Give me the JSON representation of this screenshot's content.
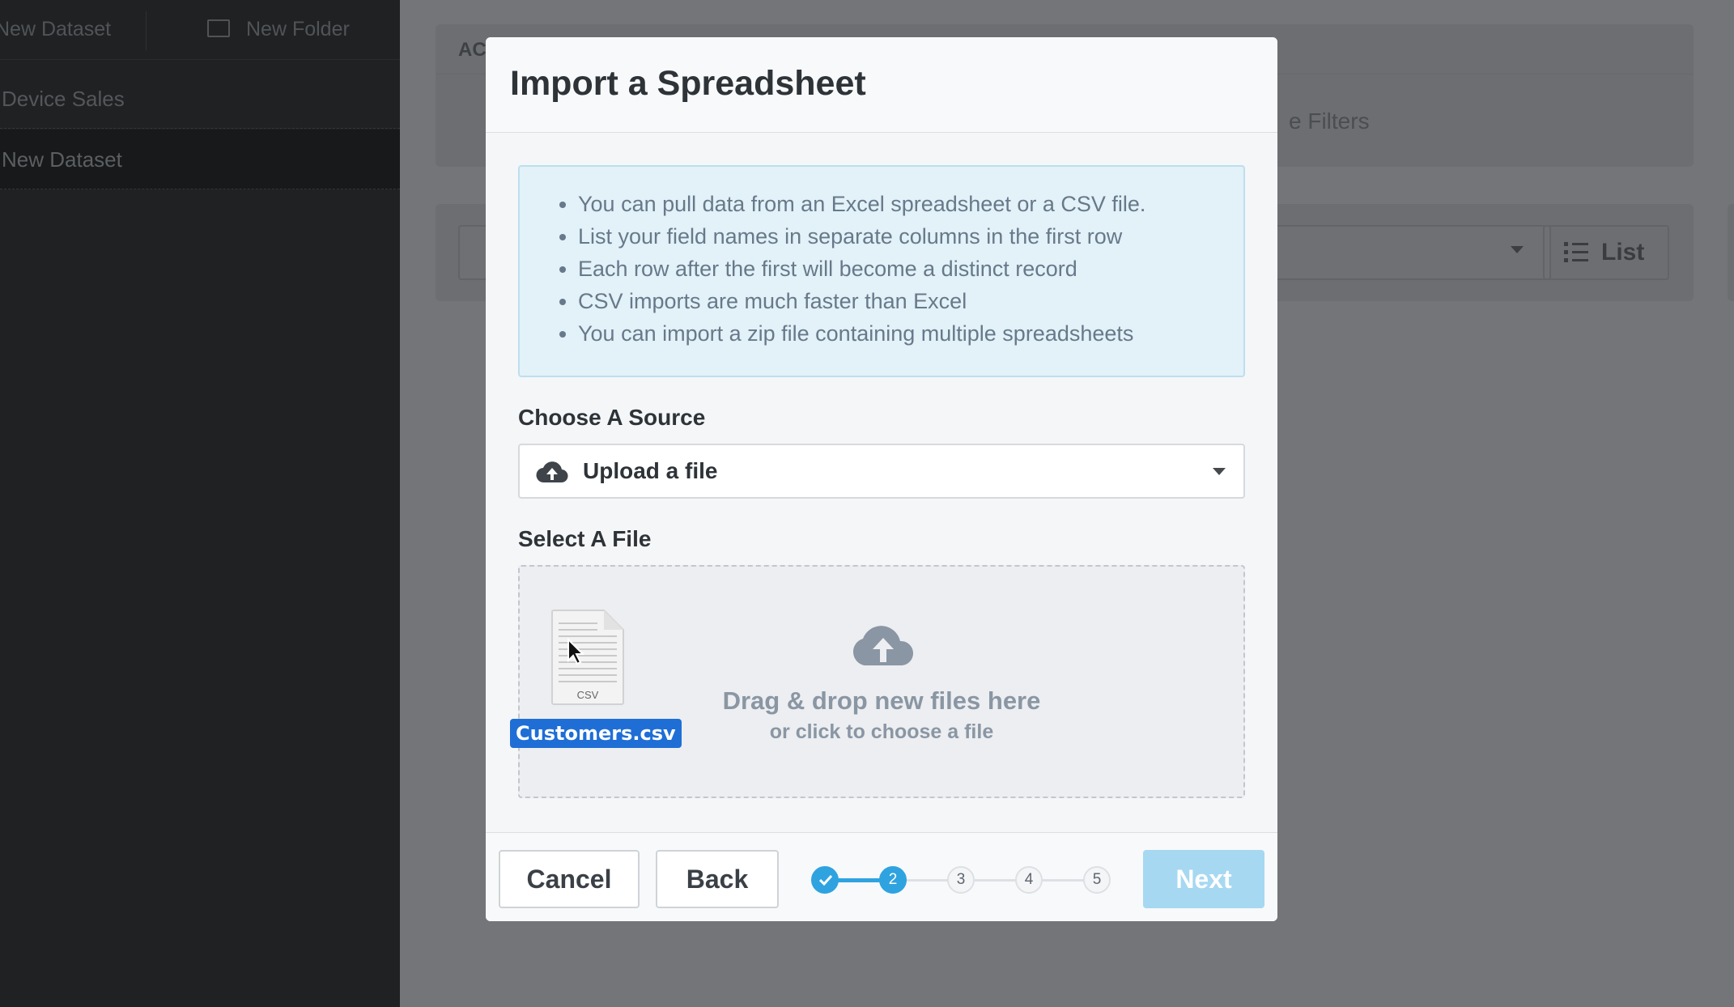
{
  "sidebar": {
    "new_dataset_label": "New Dataset",
    "new_folder_label": "New Folder",
    "items": [
      {
        "label": "Device Sales"
      },
      {
        "label": "New Dataset"
      }
    ]
  },
  "background": {
    "card_header_fragment": "AC",
    "filters_fragment": "e Filters",
    "list_button_label": "List"
  },
  "modal": {
    "title": "Import a Spreadsheet",
    "tips": [
      "You can pull data from an Excel spreadsheet or a CSV file.",
      "List your field names in separate columns in the first row",
      "Each row after the first will become a distinct record",
      "CSV imports are much faster than Excel",
      "You can import a zip file containing multiple spreadsheets"
    ],
    "source_label": "Choose A Source",
    "source_value": "Upload a file",
    "file_label": "Select A File",
    "dropzone_primary": "Drag & drop new files here",
    "dropzone_secondary": "or click to choose a file"
  },
  "footer": {
    "cancel_label": "Cancel",
    "back_label": "Back",
    "next_label": "Next",
    "steps": [
      "",
      "2",
      "3",
      "4",
      "5"
    ],
    "current_step": 2
  },
  "drag": {
    "file_name": "Customers.csv",
    "file_ext": "CSV"
  },
  "colors": {
    "accent": "#2fa3e0",
    "next_disabled": "#a6d8f2",
    "drag_label": "#1f6ed6"
  }
}
